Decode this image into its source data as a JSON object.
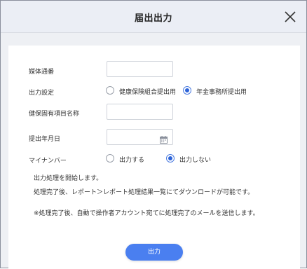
{
  "dialog": {
    "title": "届出出力",
    "close_icon": "close-icon"
  },
  "form": {
    "media_number": {
      "label": "媒体通番",
      "value": ""
    },
    "output_setting": {
      "label": "出力設定",
      "options": [
        {
          "label": "健康保険組合提出用",
          "checked": false
        },
        {
          "label": "年金事務所提出用",
          "checked": true
        }
      ]
    },
    "insurance_item": {
      "label": "健保固有項目名称",
      "value": ""
    },
    "submit_date": {
      "label": "提出年月日",
      "value": "",
      "icon": "calendar-icon"
    },
    "my_number": {
      "label": "マイナンバー",
      "options": [
        {
          "label": "出力する",
          "checked": false
        },
        {
          "label": "出力しない",
          "checked": true
        }
      ]
    }
  },
  "notes": {
    "line1": "出力処理を開始します。",
    "line2": "処理完了後、レポート＞レポート処理結果一覧にてダウンロードが可能です。",
    "line3": "※処理完了後、自動で操作者アカウント宛てに処理完了のメールを送信します。"
  },
  "actions": {
    "submit_label": "出力"
  },
  "colors": {
    "accent": "#4a7ff0",
    "header_bg": "#ebeef5",
    "radio_checked": "#2d63d8"
  }
}
